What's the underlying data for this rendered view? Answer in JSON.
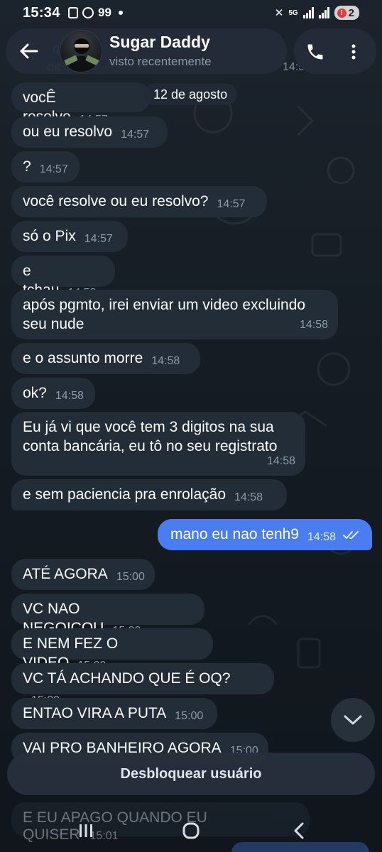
{
  "status_bar": {
    "time": "15:34",
    "notification_count": "99",
    "network": "5G",
    "battery_level": "2"
  },
  "header": {
    "contact_name": "Sugar Daddy",
    "contact_status": "visto recentemente"
  },
  "date_separator": "12 de agosto",
  "messages": [
    {
      "text": "vocÊ resolve",
      "time": "14:57",
      "direction": "in"
    },
    {
      "text": "ou eu resolvo",
      "time": "14:57",
      "direction": "in"
    },
    {
      "text": "?",
      "time": "14:57",
      "direction": "in"
    },
    {
      "text": "você resolve ou eu resolvo?",
      "time": "14:57",
      "direction": "in"
    },
    {
      "text": "só o Pix",
      "time": "14:57",
      "direction": "in"
    },
    {
      "text": "e tchau",
      "time": "14:58",
      "direction": "in"
    },
    {
      "text": "após pgmto, irei enviar um video excluindo seu nude",
      "time": "14:58",
      "direction": "in"
    },
    {
      "text": "e o assunto morre",
      "time": "14:58",
      "direction": "in"
    },
    {
      "text": "ok?",
      "time": "14:58",
      "direction": "in"
    },
    {
      "text": "Eu já vi que você tem 3 digitos na sua conta bancária, eu tô no seu registrato",
      "time": "14:58",
      "direction": "in"
    },
    {
      "text": "e sem paciencia pra enrolação",
      "time": "14:58",
      "direction": "in"
    },
    {
      "text": "mano eu nao tenh9",
      "time": "14:58",
      "direction": "out",
      "read": true
    },
    {
      "text": "ATÉ AGORA",
      "time": "15:00",
      "direction": "in"
    },
    {
      "text": "VC NAO NEGOICOU",
      "time": "15:00",
      "direction": "in"
    },
    {
      "text": "E NEM FEZ O VIDEO",
      "time": "15:00",
      "direction": "in"
    },
    {
      "text": "VC TÁ ACHANDO QUE É OQ?",
      "time": "15:00",
      "direction": "in"
    },
    {
      "text": "ENTAO VIRA A PUTA",
      "time": "15:00",
      "direction": "in"
    },
    {
      "text": "VAI PRO BANHEIRO AGORA",
      "time": "15:00",
      "direction": "in"
    },
    {
      "text": "E EU APAGO QUANDO EU QUISER",
      "time": "15:01",
      "direction": "in"
    }
  ],
  "unblock_label": "Desbloquear usuário",
  "icons": {
    "back": "arrow-left-icon",
    "call": "phone-icon",
    "menu": "more-vertical-icon",
    "scroll": "chevron-down-icon",
    "nav_recents": "recents-icon",
    "nav_home": "home-icon",
    "nav_back": "back-icon"
  },
  "colors": {
    "background": "#141b22",
    "incoming_bubble": "#222d38",
    "outgoing_bubble": "#4a7ef0",
    "timestamp": "#8c9aa7"
  }
}
